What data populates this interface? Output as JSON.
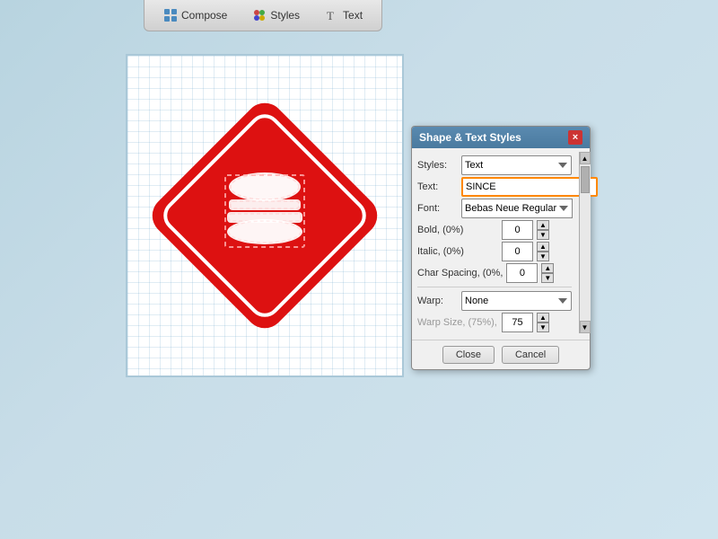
{
  "toolbar": {
    "title": "Shape & Text Styles",
    "buttons": [
      {
        "id": "compose",
        "label": "Compose",
        "icon": "compose-icon"
      },
      {
        "id": "styles",
        "label": "Styles",
        "icon": "styles-icon"
      },
      {
        "id": "text",
        "label": "Text",
        "icon": "text-icon"
      }
    ]
  },
  "dialog": {
    "title": "Shape & Text Styles",
    "close_label": "×",
    "styles_label": "Styles:",
    "styles_value": "Text",
    "text_label": "Text:",
    "text_value": "SINCE",
    "font_label": "Font:",
    "font_value": "Bebas Neue Regular",
    "bold_label": "Bold, (0%)",
    "bold_value": "0",
    "italic_label": "Italic, (0%)",
    "italic_value": "0",
    "char_spacing_label": "Char Spacing, (0%,",
    "char_spacing_value": "0",
    "warp_label": "Warp:",
    "warp_value": "None",
    "warp_size_label": "Warp Size, (75%),",
    "warp_size_value": "75",
    "close_btn": "Close",
    "cancel_btn": "Cancel"
  },
  "canvas": {
    "alt": "Logo design canvas with red diamond burger icon"
  }
}
